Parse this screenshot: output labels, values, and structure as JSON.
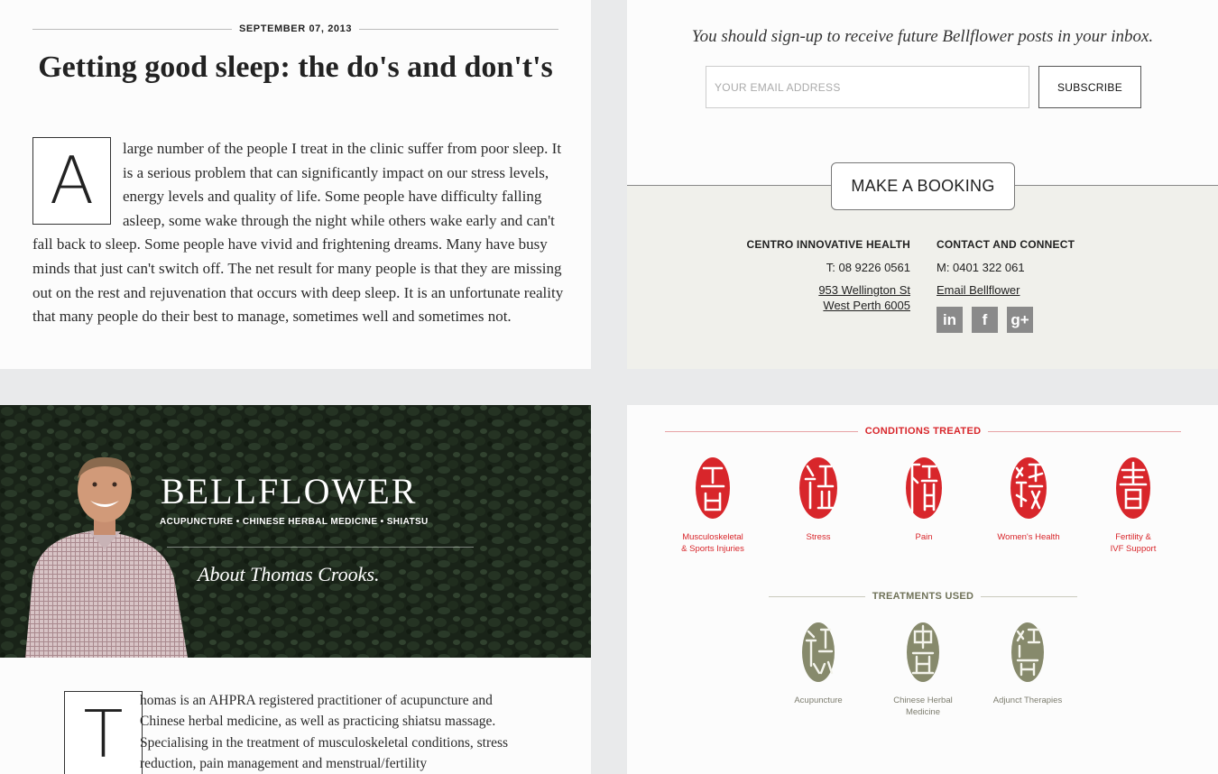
{
  "article": {
    "date": "SEPTEMBER 07, 2013",
    "title": "Getting good sleep: the do's and don't's",
    "dropcap": "A",
    "body": "large number of the people I treat in the clinic suffer from poor sleep. It is a serious problem that can significantly impact on our stress levels, energy levels and quality of life. Some people have difficulty falling asleep, some wake through the night while others wake early and can't fall back to sleep. Some people have vivid and frightening dreams. Many have busy minds that just can't switch off. The net result for many people is that they are missing out on the rest and rejuvenation that occurs with deep sleep. It is an unfortunate reality that many people do their best to manage, sometimes well and sometimes not."
  },
  "subscribe": {
    "prompt": "You should sign-up to receive future Bellflower posts in your inbox.",
    "email_placeholder": "YOUR EMAIL ADDRESS",
    "button": "SUBSCRIBE"
  },
  "booking": {
    "button": "MAKE A BOOKING"
  },
  "contact": {
    "left_heading": "CENTRO INNOVATIVE HEALTH",
    "phone": "T: 08 9226 0561",
    "address_line1": "953 Wellington St",
    "address_line2": "West Perth 6005",
    "right_heading": "CONTACT AND CONNECT",
    "mobile": "M: 0401 322 061",
    "email_link": "Email Bellflower",
    "social": [
      {
        "icon": "linkedin-icon",
        "glyph": "in"
      },
      {
        "icon": "facebook-icon",
        "glyph": "f"
      },
      {
        "icon": "googleplus-icon",
        "glyph": "g+"
      }
    ]
  },
  "about": {
    "brand": "BELLFLOWER",
    "tagline": "ACUPUNCTURE • CHINESE HERBAL MEDICINE • SHIATSU",
    "title": "About Thomas Crooks.",
    "dropcap": "T",
    "body": "homas is an AHPRA registered practitioner of acupuncture and Chinese herbal medicine, as well as practicing shiatsu massage. Specialising in the treatment of musculoskeletal conditions, stress reduction, pain management and menstrual/fertility"
  },
  "conditions": {
    "heading": "CONDITIONS TREATED",
    "items": [
      {
        "label1": "Musculoskeletal",
        "label2": "& Sports Injuries"
      },
      {
        "label1": "Stress",
        "label2": ""
      },
      {
        "label1": "Pain",
        "label2": ""
      },
      {
        "label1": "Women's Health",
        "label2": ""
      },
      {
        "label1": "Fertility &",
        "label2": "IVF Support"
      }
    ]
  },
  "treatments": {
    "heading": "TREATMENTS USED",
    "items": [
      {
        "label1": "Acupuncture",
        "label2": ""
      },
      {
        "label1": "Chinese Herbal",
        "label2": "Medicine"
      },
      {
        "label1": "Adjunct Therapies",
        "label2": ""
      }
    ]
  },
  "colors": {
    "accent_red": "#d8262b",
    "treatment_olive": "#878a6c",
    "footer_bg": "#f0f0eb",
    "hero_bg": "#1f2c1e"
  }
}
